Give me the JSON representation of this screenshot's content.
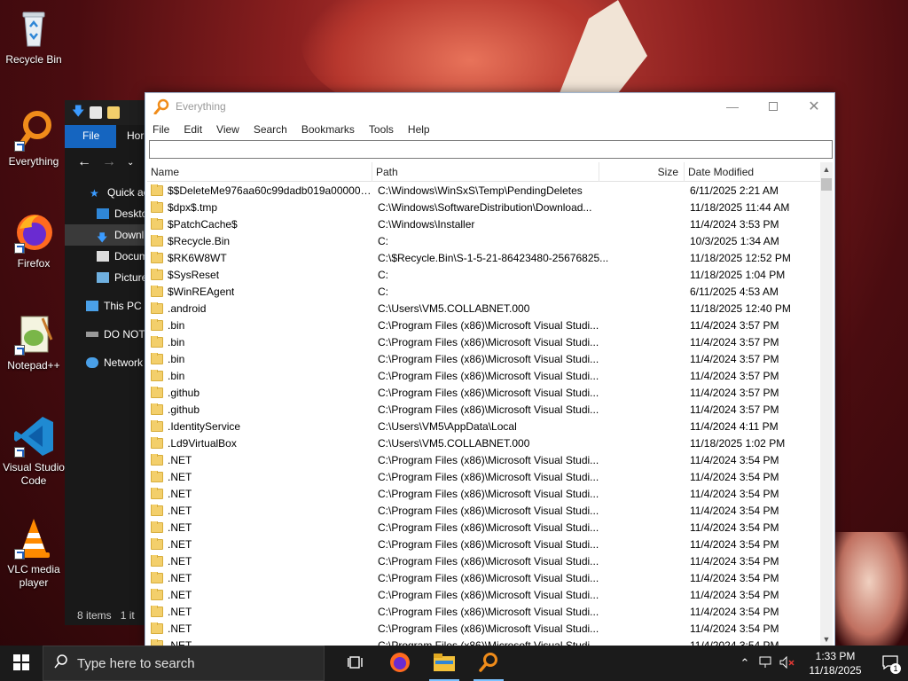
{
  "desktop": {
    "icons": [
      {
        "label": "Recycle Bin"
      },
      {
        "label": "Everything"
      },
      {
        "label": "Firefox"
      },
      {
        "label": "Notepad++"
      },
      {
        "label": "Visual Studio Code"
      },
      {
        "label": "VLC media player"
      }
    ]
  },
  "explorer": {
    "tab_file": "File",
    "tab_home": "Hor",
    "tree": [
      {
        "label": "Quick ac"
      },
      {
        "label": "Deskto"
      },
      {
        "label": "Downl"
      },
      {
        "label": "Docum"
      },
      {
        "label": "Picture"
      },
      {
        "label": "This PC"
      },
      {
        "label": "DO NOT"
      },
      {
        "label": "Network"
      }
    ],
    "status_items": "8 items",
    "status_selected": "1 it"
  },
  "everything": {
    "title": "Everything",
    "menu": [
      "File",
      "Edit",
      "View",
      "Search",
      "Bookmarks",
      "Tools",
      "Help"
    ],
    "search_value": "",
    "columns": {
      "name": "Name",
      "path": "Path",
      "size": "Size",
      "date": "Date Modified"
    },
    "rows": [
      {
        "name": "$$DeleteMe976aa60c99dadb019a0000005c...",
        "path": "C:\\Windows\\WinSxS\\Temp\\PendingDeletes",
        "size": "",
        "date": "6/11/2025 2:21 AM"
      },
      {
        "name": "$dpx$.tmp",
        "path": "C:\\Windows\\SoftwareDistribution\\Download...",
        "size": "",
        "date": "11/18/2025 11:44 AM"
      },
      {
        "name": "$PatchCache$",
        "path": "C:\\Windows\\Installer",
        "size": "",
        "date": "11/4/2024 3:53 PM"
      },
      {
        "name": "$Recycle.Bin",
        "path": "C:",
        "size": "",
        "date": "10/3/2025 1:34 AM"
      },
      {
        "name": "$RK6W8WT",
        "path": "C:\\$Recycle.Bin\\S-1-5-21-86423480-25676825...",
        "size": "",
        "date": "11/18/2025 12:52 PM"
      },
      {
        "name": "$SysReset",
        "path": "C:",
        "size": "",
        "date": "11/18/2025 1:04 PM"
      },
      {
        "name": "$WinREAgent",
        "path": "C:",
        "size": "",
        "date": "6/11/2025 4:53 AM"
      },
      {
        "name": ".android",
        "path": "C:\\Users\\VM5.COLLABNET.000",
        "size": "",
        "date": "11/18/2025 12:40 PM"
      },
      {
        "name": ".bin",
        "path": "C:\\Program Files (x86)\\Microsoft Visual Studi...",
        "size": "",
        "date": "11/4/2024 3:57 PM"
      },
      {
        "name": ".bin",
        "path": "C:\\Program Files (x86)\\Microsoft Visual Studi...",
        "size": "",
        "date": "11/4/2024 3:57 PM"
      },
      {
        "name": ".bin",
        "path": "C:\\Program Files (x86)\\Microsoft Visual Studi...",
        "size": "",
        "date": "11/4/2024 3:57 PM"
      },
      {
        "name": ".bin",
        "path": "C:\\Program Files (x86)\\Microsoft Visual Studi...",
        "size": "",
        "date": "11/4/2024 3:57 PM"
      },
      {
        "name": ".github",
        "path": "C:\\Program Files (x86)\\Microsoft Visual Studi...",
        "size": "",
        "date": "11/4/2024 3:57 PM"
      },
      {
        "name": ".github",
        "path": "C:\\Program Files (x86)\\Microsoft Visual Studi...",
        "size": "",
        "date": "11/4/2024 3:57 PM"
      },
      {
        "name": ".IdentityService",
        "path": "C:\\Users\\VM5\\AppData\\Local",
        "size": "",
        "date": "11/4/2024 4:11 PM"
      },
      {
        "name": ".Ld9VirtualBox",
        "path": "C:\\Users\\VM5.COLLABNET.000",
        "size": "",
        "date": "11/18/2025 1:02 PM"
      },
      {
        "name": ".NET",
        "path": "C:\\Program Files (x86)\\Microsoft Visual Studi...",
        "size": "",
        "date": "11/4/2024 3:54 PM"
      },
      {
        "name": ".NET",
        "path": "C:\\Program Files (x86)\\Microsoft Visual Studi...",
        "size": "",
        "date": "11/4/2024 3:54 PM"
      },
      {
        "name": ".NET",
        "path": "C:\\Program Files (x86)\\Microsoft Visual Studi...",
        "size": "",
        "date": "11/4/2024 3:54 PM"
      },
      {
        "name": ".NET",
        "path": "C:\\Program Files (x86)\\Microsoft Visual Studi...",
        "size": "",
        "date": "11/4/2024 3:54 PM"
      },
      {
        "name": ".NET",
        "path": "C:\\Program Files (x86)\\Microsoft Visual Studi...",
        "size": "",
        "date": "11/4/2024 3:54 PM"
      },
      {
        "name": ".NET",
        "path": "C:\\Program Files (x86)\\Microsoft Visual Studi...",
        "size": "",
        "date": "11/4/2024 3:54 PM"
      },
      {
        "name": ".NET",
        "path": "C:\\Program Files (x86)\\Microsoft Visual Studi...",
        "size": "",
        "date": "11/4/2024 3:54 PM"
      },
      {
        "name": ".NET",
        "path": "C:\\Program Files (x86)\\Microsoft Visual Studi...",
        "size": "",
        "date": "11/4/2024 3:54 PM"
      },
      {
        "name": ".NET",
        "path": "C:\\Program Files (x86)\\Microsoft Visual Studi...",
        "size": "",
        "date": "11/4/2024 3:54 PM"
      },
      {
        "name": ".NET",
        "path": "C:\\Program Files (x86)\\Microsoft Visual Studi...",
        "size": "",
        "date": "11/4/2024 3:54 PM"
      },
      {
        "name": ".NET",
        "path": "C:\\Program Files (x86)\\Microsoft Visual Studi...",
        "size": "",
        "date": "11/4/2024 3:54 PM"
      },
      {
        "name": ".NET",
        "path": "C:\\Program Files (x86)\\Microsoft Visual Studi...",
        "size": "",
        "date": "11/4/2024 3:54 PM"
      }
    ]
  },
  "taskbar": {
    "search_placeholder": "Type here to search",
    "time": "1:33 PM",
    "date": "11/18/2025",
    "notification_count": "1"
  }
}
